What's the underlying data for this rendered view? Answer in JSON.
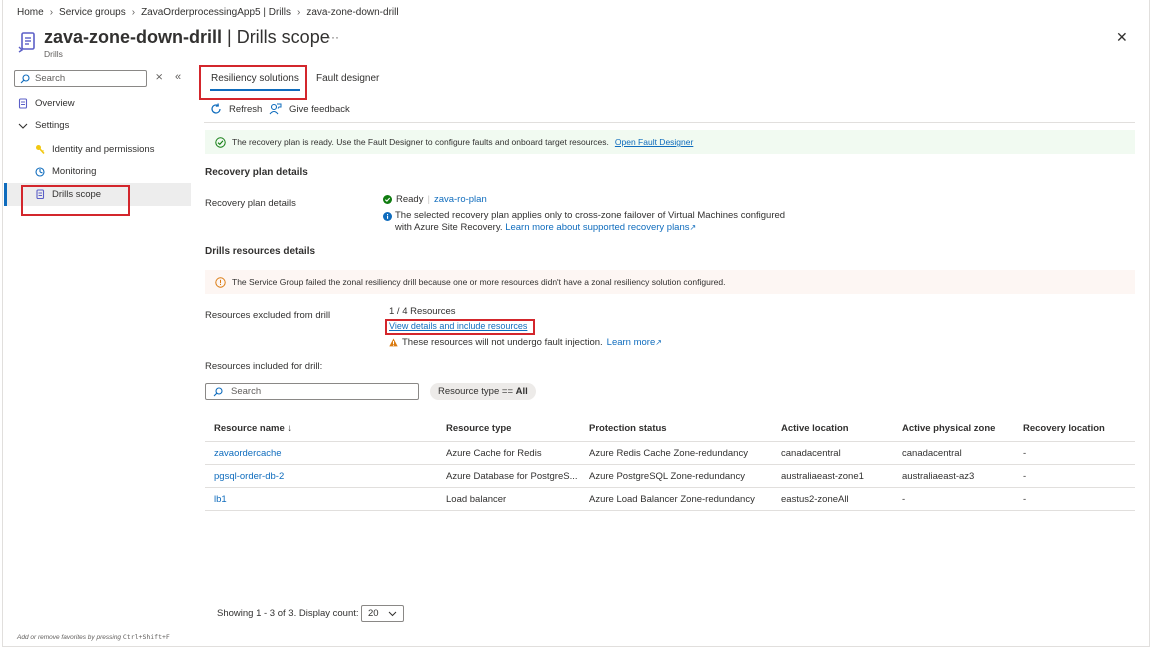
{
  "breadcrumb": [
    "Home",
    "Service groups",
    "ZavaOrderprocessingApp5 | Drills",
    "zava-zone-down-drill"
  ],
  "header": {
    "title_bold": "zava-zone-down-drill",
    "title_rest": " | Drills scope",
    "subtitle": "Drills",
    "more": "···",
    "close": "✕"
  },
  "sidebar": {
    "search_placeholder": "Search",
    "items": [
      {
        "label": "Overview",
        "icon": "document-icon"
      },
      {
        "label": "Settings",
        "icon": "chevron-down-icon"
      },
      {
        "label": "Identity and permissions",
        "icon": "key-icon"
      },
      {
        "label": "Monitoring",
        "icon": "monitoring-icon"
      },
      {
        "label": "Drills scope",
        "icon": "drills-icon"
      }
    ]
  },
  "tabs": [
    "Resiliency solutions",
    "Fault designer"
  ],
  "commands": {
    "refresh": "Refresh",
    "feedback": "Give feedback"
  },
  "banner_success": {
    "text": "The recovery plan is ready. Use the Fault Designer to configure faults and onboard target resources.",
    "link": "Open Fault Designer"
  },
  "recovery": {
    "section_title": "Recovery plan details",
    "label": "Recovery plan details",
    "status": "Ready",
    "plan_link": "zava-ro-plan",
    "info_line1": "The selected recovery plan applies only to cross-zone failover of Virtual Machines configured",
    "info_line2": "with Azure Site Recovery.",
    "info_link": "Learn more about supported recovery plans"
  },
  "drills": {
    "section_title": "Drills resources details",
    "warning": "The Service Group failed the zonal resiliency drill because one or more resources didn't have a zonal resiliency solution configured.",
    "excluded_label": "Resources excluded from drill",
    "excluded_count": "1 / 4 Resources",
    "excluded_link": "View details and include resources",
    "excluded_note": "These resources will not undergo fault injection.",
    "excluded_note_link": "Learn more",
    "included_label": "Resources included for drill:"
  },
  "table": {
    "search_placeholder": "Search",
    "filter_prefix": "Resource type == ",
    "filter_value": "All",
    "headers": [
      "Resource name ↓",
      "Resource type",
      "Protection status",
      "Active location",
      "Active physical zone",
      "Recovery location"
    ],
    "rows": [
      [
        "zavaordercache",
        "Azure Cache for Redis",
        "Azure Redis Cache Zone-redundancy",
        "canadacentral",
        "canadacentral",
        "-"
      ],
      [
        "pgsql-order-db-2",
        "Azure Database for PostgreS...",
        "Azure PostgreSQL Zone-redundancy",
        "australiaeast-zone1",
        "australiaeast-az3",
        "-"
      ],
      [
        "lb1",
        "Load balancer",
        "Azure Load Balancer Zone-redundancy",
        "eastus2-zoneAll",
        "-",
        "-"
      ]
    ]
  },
  "pagination": {
    "text": "Showing 1 - 3 of 3. Display count:",
    "count": "20"
  },
  "footer": {
    "hint": "Add or remove favorites by pressing",
    "shortcut": "Ctrl+Shift+F"
  },
  "colors": {
    "accent": "#0f6cbd",
    "highlight": "#d3262c",
    "success": "#107c10",
    "warning": "#da7b11"
  }
}
